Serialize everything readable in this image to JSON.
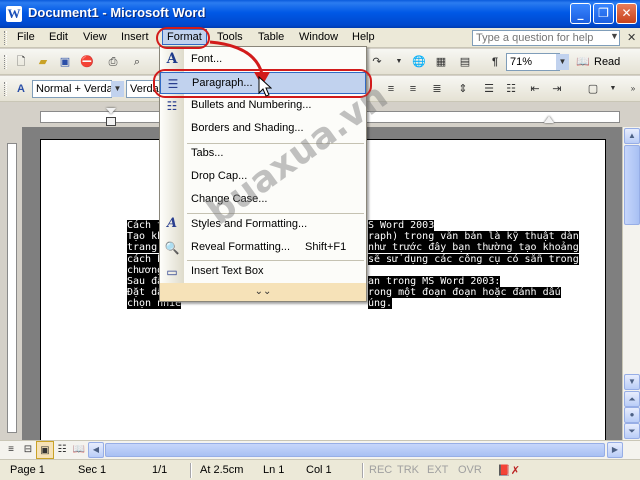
{
  "window": {
    "title": "Document1 - Microsoft Word"
  },
  "menubar": {
    "items": [
      "File",
      "Edit",
      "View",
      "Insert",
      "Format",
      "Tools",
      "Table",
      "Window",
      "Help"
    ],
    "active": "Format",
    "ask_placeholder": "Type a question for help"
  },
  "toolbar_standard": {
    "zoom": "71%",
    "read_label": "Read"
  },
  "toolbar_formatting": {
    "style": "Normal + Verda",
    "font": "Verda"
  },
  "format_menu": {
    "items": [
      {
        "label": "Font...",
        "icon": "font-icon"
      },
      {
        "label": "Paragraph...",
        "icon": "paragraph-icon",
        "highlighted": true
      },
      {
        "label": "Bullets and Numbering...",
        "icon": "bullets-icon"
      },
      {
        "label": "Borders and Shading...",
        "icon": ""
      },
      {
        "label": "Tabs...",
        "icon": ""
      },
      {
        "label": "Drop Cap...",
        "icon": ""
      },
      {
        "label": "Change Case...",
        "icon": ""
      },
      {
        "label": "Styles and Formatting...",
        "icon": "styles-icon"
      },
      {
        "label": "Reveal Formatting...",
        "shortcut": "Shift+F1",
        "icon": "reveal-icon"
      },
      {
        "label": "Insert Text Box",
        "icon": "textbox-icon"
      }
    ],
    "expand_icon": "chevron-double-down-icon"
  },
  "document": {
    "lines": [
      "Cách tạo k",
      "Tạo khoản",
      "trang giúp",
      "cách bằng",
      "chương tri",
      "Sau đây là",
      "Đặt dấu n",
      "chọn nhiề"
    ],
    "lines_right": [
      "S Word 2003",
      "raph) trong văn bản là kỹ thuật dàn",
      "như trước đây bạn thường tạo khoảng",
      "sẽ sử dụng các công cụ có sẵn trong",
      "",
      "an trong MS Word 2003:",
      "rong một đoạn đoạn hoặc đánh dấu",
      "úng."
    ],
    "watermark": "buaxua.vn"
  },
  "statusbar": {
    "page": "Page 1",
    "sec": "Sec 1",
    "pages": "1/1",
    "at": "At 2.5cm",
    "ln": "Ln 1",
    "col": "Col 1",
    "rec": "REC",
    "trk": "TRK",
    "ext": "EXT",
    "ovr": "OVR"
  },
  "colors": {
    "titlebar": "#0058e6",
    "menu_highlight": "#c1d2ee",
    "annotation_red": "#d21b1b"
  }
}
